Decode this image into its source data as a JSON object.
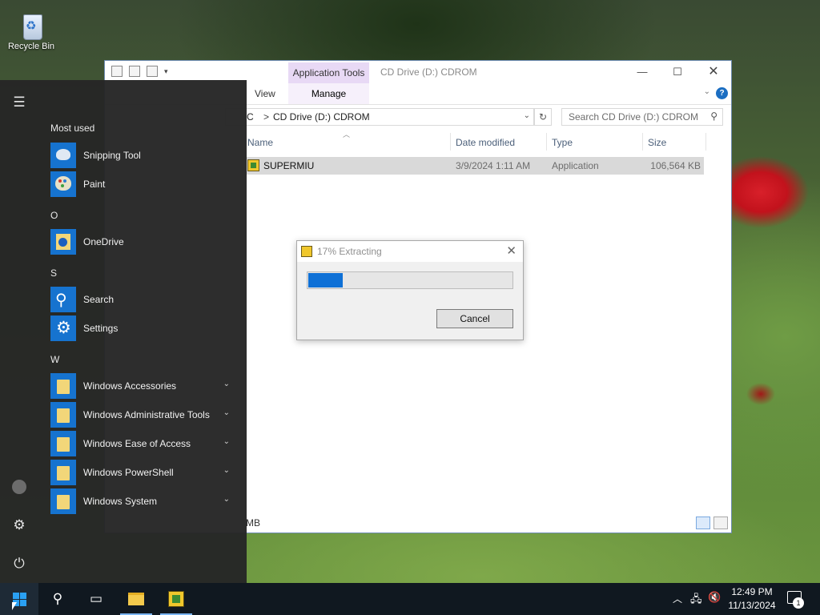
{
  "desktop": {
    "icons": [
      {
        "label": "Recycle Bin",
        "icon": "recycle-bin-icon"
      }
    ]
  },
  "explorer": {
    "title": "CD Drive (D:) CDROM",
    "contextual_tab": "Application Tools",
    "ribbon_tabs": [
      "View",
      "Manage"
    ],
    "address_prefix": "C",
    "address_separator": ">",
    "address_path": "CD Drive (D:) CDROM",
    "search_placeholder": "Search CD Drive (D:) CDROM",
    "columns": [
      "Name",
      "Date modified",
      "Type",
      "Size"
    ],
    "files": [
      {
        "name": "SUPERMIU",
        "date_modified": "3/9/2024 1:11 AM",
        "type": "Application",
        "size": "106,564 KB",
        "icon": "application-icon"
      }
    ],
    "status_text": "MB"
  },
  "dialog": {
    "title": "17% Extracting",
    "progress_percent": 17,
    "cancel_label": "Cancel"
  },
  "start_menu": {
    "sections": [
      {
        "label": "Most used",
        "items": [
          {
            "name": "Snipping Tool",
            "icon": "snipping-tool-icon"
          },
          {
            "name": "Paint",
            "icon": "paint-icon"
          }
        ]
      },
      {
        "label": "O",
        "items": [
          {
            "name": "OneDrive",
            "icon": "onedrive-icon"
          }
        ]
      },
      {
        "label": "S",
        "items": [
          {
            "name": "Search",
            "icon": "search-icon"
          },
          {
            "name": "Settings",
            "icon": "gear-icon"
          }
        ]
      },
      {
        "label": "W",
        "items": [
          {
            "name": "Windows Accessories",
            "icon": "folder-icon",
            "expandable": true
          },
          {
            "name": "Windows Administrative Tools",
            "icon": "folder-icon",
            "expandable": true
          },
          {
            "name": "Windows Ease of Access",
            "icon": "folder-icon",
            "expandable": true
          },
          {
            "name": "Windows PowerShell",
            "icon": "folder-icon",
            "expandable": true
          },
          {
            "name": "Windows System",
            "icon": "folder-icon",
            "expandable": true
          }
        ]
      }
    ],
    "rail": [
      "hamburger-icon",
      "user-icon",
      "settings-icon",
      "power-icon"
    ]
  },
  "taskbar": {
    "clock_time": "12:49 PM",
    "clock_date": "11/13/2024",
    "notification_count": "1",
    "pinned": [
      "start-icon",
      "search-icon",
      "task-view-icon",
      "file-explorer-icon",
      "supermiu-app-icon"
    ]
  },
  "colors": {
    "accent": "#1673cf",
    "progress_fill": "#0e70d6",
    "contextual_tab": "#e8d9f5",
    "taskbar": "#101820",
    "start_menu": "#262626"
  }
}
